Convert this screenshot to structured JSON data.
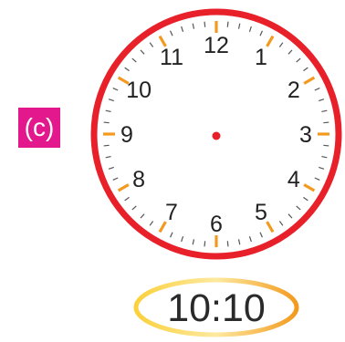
{
  "label": "(c)",
  "clock": {
    "numerals": [
      "12",
      "1",
      "2",
      "3",
      "4",
      "5",
      "6",
      "7",
      "8",
      "9",
      "10",
      "11"
    ],
    "rim_color": "#e8202a",
    "hour_mark_color": "#f39a1e",
    "minute_tick_color": "#555555",
    "center_dot_color": "#e8202a"
  },
  "time_display": {
    "text": "10:10",
    "outline_color": "#f6b21b"
  }
}
